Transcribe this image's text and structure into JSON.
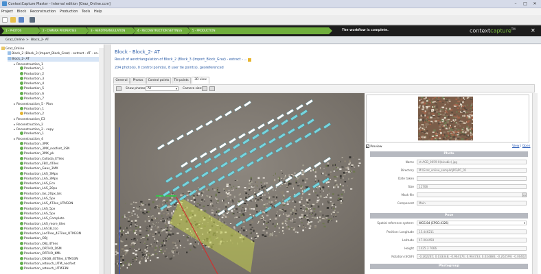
{
  "window": {
    "title": "ContextCapture Master - Internal edition [Graz_Online.ccm]",
    "minimize": "–",
    "maximize": "□",
    "close": "✕"
  },
  "menu": [
    "Project",
    "Block",
    "Reconstruction",
    "Production",
    "Tools",
    "Help"
  ],
  "workflow": {
    "steps": [
      "1 - PHOTOS",
      "2 - CAMERA PROPERTIES",
      "3 - AEROTRIANGULATION",
      "4 - RECONSTRUCTION SETTINGS",
      "5 - PRODUCTION"
    ],
    "message": "The workflow is complete.",
    "brand_a": "context",
    "brand_b": "capture",
    "brand_tm": "TM",
    "close": "✕",
    "color": "#7ec242"
  },
  "breadcrumb": [
    "Graz_Online",
    ">",
    "Block_2- AT"
  ],
  "tree": [
    {
      "label": "Graz_Online",
      "level": 0,
      "icon": "project"
    },
    {
      "label": "Block_2 (Block_3 (Import_Block_Graz) - extract - AT - co...",
      "level": 1,
      "icon": "block"
    },
    {
      "label": "Block_2- AT",
      "level": 1,
      "icon": "block",
      "selected": true
    },
    {
      "label": "Reconstruction_1",
      "level": 2,
      "icon": "none"
    },
    {
      "label": "Production_1",
      "level": 3,
      "icon": "ok"
    },
    {
      "label": "Production_2",
      "level": 3,
      "icon": "ok"
    },
    {
      "label": "Production_3",
      "level": 3,
      "icon": "ok"
    },
    {
      "label": "Production_4",
      "level": 3,
      "icon": "ok"
    },
    {
      "label": "Production_5",
      "level": 3,
      "icon": "ok"
    },
    {
      "label": "Production_6",
      "level": 3,
      "icon": "ok"
    },
    {
      "label": "Production_7",
      "level": 3,
      "icon": "ok"
    },
    {
      "label": "Reconstruction_5 - Plan",
      "level": 2,
      "icon": "none"
    },
    {
      "label": "Production_1",
      "level": 3,
      "icon": "ok"
    },
    {
      "label": "Production_2",
      "level": 3,
      "icon": "warn"
    },
    {
      "label": "Reconstruction_E3",
      "level": 2,
      "icon": "none"
    },
    {
      "label": "Reconstruction_2",
      "level": 2,
      "icon": "none"
    },
    {
      "label": "Reconstruction_2 - copy",
      "level": 2,
      "icon": "none"
    },
    {
      "label": "Production_1",
      "level": 3,
      "icon": "ok"
    },
    {
      "label": "Reconstruction_4",
      "level": 2,
      "icon": "none"
    },
    {
      "label": "Production_3MX",
      "level": 3,
      "icon": "ok"
    },
    {
      "label": "Production_3MX_noofset_3SN",
      "level": 3,
      "icon": "ok"
    },
    {
      "label": "Production_3MX_pk",
      "level": 3,
      "icon": "ok"
    },
    {
      "label": "Production_Collada_ETiles",
      "level": 3,
      "icon": "ok"
    },
    {
      "label": "Production_FBX_4Tiles",
      "level": 3,
      "icon": "ok"
    },
    {
      "label": "Production_Gaas_3MX",
      "level": 3,
      "icon": "ok"
    },
    {
      "label": "Production_LAS_3Mpx",
      "level": 3,
      "icon": "ok"
    },
    {
      "label": "Production_LAS_3Mpx",
      "level": 3,
      "icon": "ok"
    },
    {
      "label": "Production_LAS_Ecn",
      "level": 3,
      "icon": "ok"
    },
    {
      "label": "Production_LAS_20px",
      "level": 3,
      "icon": "ok"
    },
    {
      "label": "Production_las_20px_bis",
      "level": 3,
      "icon": "ok"
    },
    {
      "label": "Production_LAS_5px",
      "level": 3,
      "icon": "ok"
    },
    {
      "label": "Production_LAS_4Tiles_UTM33N",
      "level": 3,
      "icon": "ok"
    },
    {
      "label": "Production_LAS_5px",
      "level": 3,
      "icon": "ok"
    },
    {
      "label": "Production_LAS_5px",
      "level": 3,
      "icon": "ok"
    },
    {
      "label": "Production_LAS_Complete",
      "level": 3,
      "icon": "ok"
    },
    {
      "label": "Production_LAS_more_tiles",
      "level": 3,
      "icon": "ok"
    },
    {
      "label": "Production_LAS18_tco",
      "level": 3,
      "icon": "ok"
    },
    {
      "label": "Production_LodTree_4ETiles_UTM33N",
      "level": 3,
      "icon": "ok"
    },
    {
      "label": "Production_OBJ",
      "level": 3,
      "icon": "ok"
    },
    {
      "label": "Production_OBJ_4Tiles",
      "level": 3,
      "icon": "ok"
    },
    {
      "label": "Production_ORTHO_DSM",
      "level": 3,
      "icon": "ok"
    },
    {
      "label": "Production_ORTHO_KML",
      "level": 3,
      "icon": "ok"
    },
    {
      "label": "Production_OSGB_4ETiles_UTM33N",
      "level": 3,
      "icon": "ok"
    },
    {
      "label": "Production_retouch_UTM_noofset",
      "level": 3,
      "icon": "ok"
    },
    {
      "label": "Production_retouch_UTM33N",
      "level": 3,
      "icon": "ok"
    }
  ],
  "content": {
    "title": "Block - Block_2- AT",
    "subtitle": "Result of aerotriangulation of Block_2 (Block_3 (Import_Block_Graz) - extract - ...",
    "stats": "204 photo(s), 0 control point(s), 8 user tie point(s), georeferenced",
    "tabs": [
      "General",
      "Photos",
      "Control points",
      "Tie points",
      "3D view"
    ],
    "active_tab": "3D view",
    "show_photos_label": "Show photos:",
    "show_photos_value": "All",
    "camera_size_label": "Camera size:"
  },
  "preview": {
    "checkbox_label": "Preview",
    "view_link": "View",
    "sep": "|",
    "open_link": "Open"
  },
  "photo": {
    "header": "Photo",
    "fields": [
      {
        "label": "Name",
        "value": "ct-AGB_0059-0(bicubic).jpg"
      },
      {
        "label": "Directory",
        "value": "M:\\Graz_online_sample\\JPG\\PC_01"
      },
      {
        "label": "Date taken",
        "value": ""
      },
      {
        "label": "Size",
        "value": "11708"
      },
      {
        "label": "Mask file",
        "value": ""
      },
      {
        "label": "Component",
        "value": "Main"
      }
    ]
  },
  "pose": {
    "header": "Pose",
    "srs_label": "Spatial reference system:",
    "srs_value": "WGS 84 (EPSG:4326)",
    "fields": [
      {
        "label": "Position: Longitude",
        "value": "15.446211"
      },
      {
        "label": "Latitude",
        "value": "47.064458"
      },
      {
        "label": "Height",
        "value": "1425.3 7666"
      },
      {
        "label": "Rotation (ECEF)",
        "value": "-0.262265; 0.033348; -0.964174; 0.964733; 0.024886; -0.262599; -0.004026; 0.99445"
      }
    ]
  },
  "photogroup": {
    "header": "Photogroup"
  }
}
